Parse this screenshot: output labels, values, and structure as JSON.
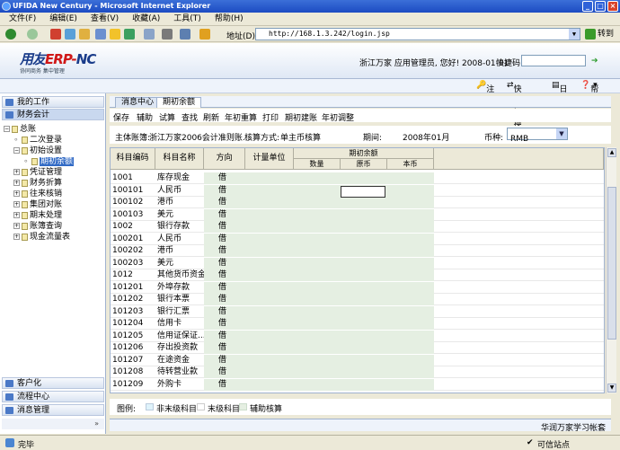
{
  "window": {
    "title": "UFIDA New Century - Microsoft Internet Explorer"
  },
  "ie_menu": [
    "文件(F)",
    "编辑(E)",
    "查看(V)",
    "收藏(A)",
    "工具(T)",
    "帮助(H)"
  ],
  "address": {
    "label": "地址(D)",
    "url": "http://168.1.3.242/login.jsp",
    "go": "转到"
  },
  "app": {
    "logo_main": "用友",
    "logo_erp": "ERP-",
    "logo_tail": "NC",
    "logo_sub": "协同商务   集中管理",
    "user_info": "浙江万家 应用管理员, 您好! 2008-01-01",
    "quick_label": "快捷码"
  },
  "links": {
    "logout": "注销",
    "quick_switch": "快速切换",
    "log": "日志",
    "help": "帮助"
  },
  "left_nav": {
    "my_work": "我的工作",
    "finance": "财务会计",
    "tree": [
      {
        "label": "总账",
        "level": 0,
        "kind": "folder-open"
      },
      {
        "label": "二次登录",
        "level": 1,
        "kind": "leaf"
      },
      {
        "label": "初始设置",
        "level": 1,
        "kind": "folder-open"
      },
      {
        "label": "期初余额",
        "level": 2,
        "kind": "leaf",
        "selected": true
      },
      {
        "label": "凭证管理",
        "level": 1,
        "kind": "folder"
      },
      {
        "label": "财务折算",
        "level": 1,
        "kind": "folder"
      },
      {
        "label": "往来核销",
        "level": 1,
        "kind": "folder"
      },
      {
        "label": "集团对账",
        "level": 1,
        "kind": "folder"
      },
      {
        "label": "期末处理",
        "level": 1,
        "kind": "folder"
      },
      {
        "label": "账簿查询",
        "level": 1,
        "kind": "folder"
      },
      {
        "label": "现金流量表",
        "level": 1,
        "kind": "folder"
      }
    ],
    "bottom": [
      "客户化",
      "流程中心",
      "消息管理"
    ]
  },
  "tabs": [
    {
      "label": "消息中心"
    },
    {
      "label": "期初余额",
      "active": true
    }
  ],
  "actions": [
    "保存",
    "辅助",
    "试算",
    "查找",
    "刷新",
    "年初重算",
    "打印",
    "期初建账",
    "年初调整"
  ],
  "filter": {
    "book_label": "主体账簿:",
    "book_value": "浙江万家2006会计准则账...",
    "method_label": "核算方式:",
    "method_value": "单主币核算",
    "period_label": "期间:",
    "period_value": "2008年01月",
    "currency_label": "币种:",
    "currency_value": "RMB"
  },
  "grid": {
    "headers": {
      "code": "科目编码",
      "name": "科目名称",
      "dir": "方向",
      "unit": "计量单位",
      "group": "期初余额",
      "qty": "数量",
      "orig": "原币",
      "local": "本币"
    },
    "rows": [
      [
        "1001",
        "库存现金",
        "借"
      ],
      [
        "100101",
        "人民币",
        "借"
      ],
      [
        "100102",
        "港币",
        "借"
      ],
      [
        "100103",
        "美元",
        "借"
      ],
      [
        "1002",
        "银行存款",
        "借"
      ],
      [
        "100201",
        "人民币",
        "借"
      ],
      [
        "100202",
        "港币",
        "借"
      ],
      [
        "100203",
        "美元",
        "借"
      ],
      [
        "1012",
        "其他货币资金",
        "借"
      ],
      [
        "101201",
        "外埠存款",
        "借"
      ],
      [
        "101202",
        "银行本票",
        "借"
      ],
      [
        "101203",
        "银行汇票",
        "借"
      ],
      [
        "101204",
        "信用卡",
        "借"
      ],
      [
        "101205",
        "信用证保证...",
        "借"
      ],
      [
        "101206",
        "存出投资款",
        "借"
      ],
      [
        "101207",
        "在途资金",
        "借"
      ],
      [
        "101208",
        "待转营业款",
        "借"
      ],
      [
        "101209",
        "外购卡",
        "借"
      ]
    ]
  },
  "legend": {
    "title": "图例:",
    "items": [
      "非末级科目",
      "末级科目",
      "辅助核算"
    ],
    "colors": [
      "#dff3fb",
      "#ffffff",
      "#e5efe2"
    ]
  },
  "footer": {
    "text": "华润万家学习帐套"
  },
  "status": {
    "left": "完毕",
    "zone": "可信站点"
  }
}
